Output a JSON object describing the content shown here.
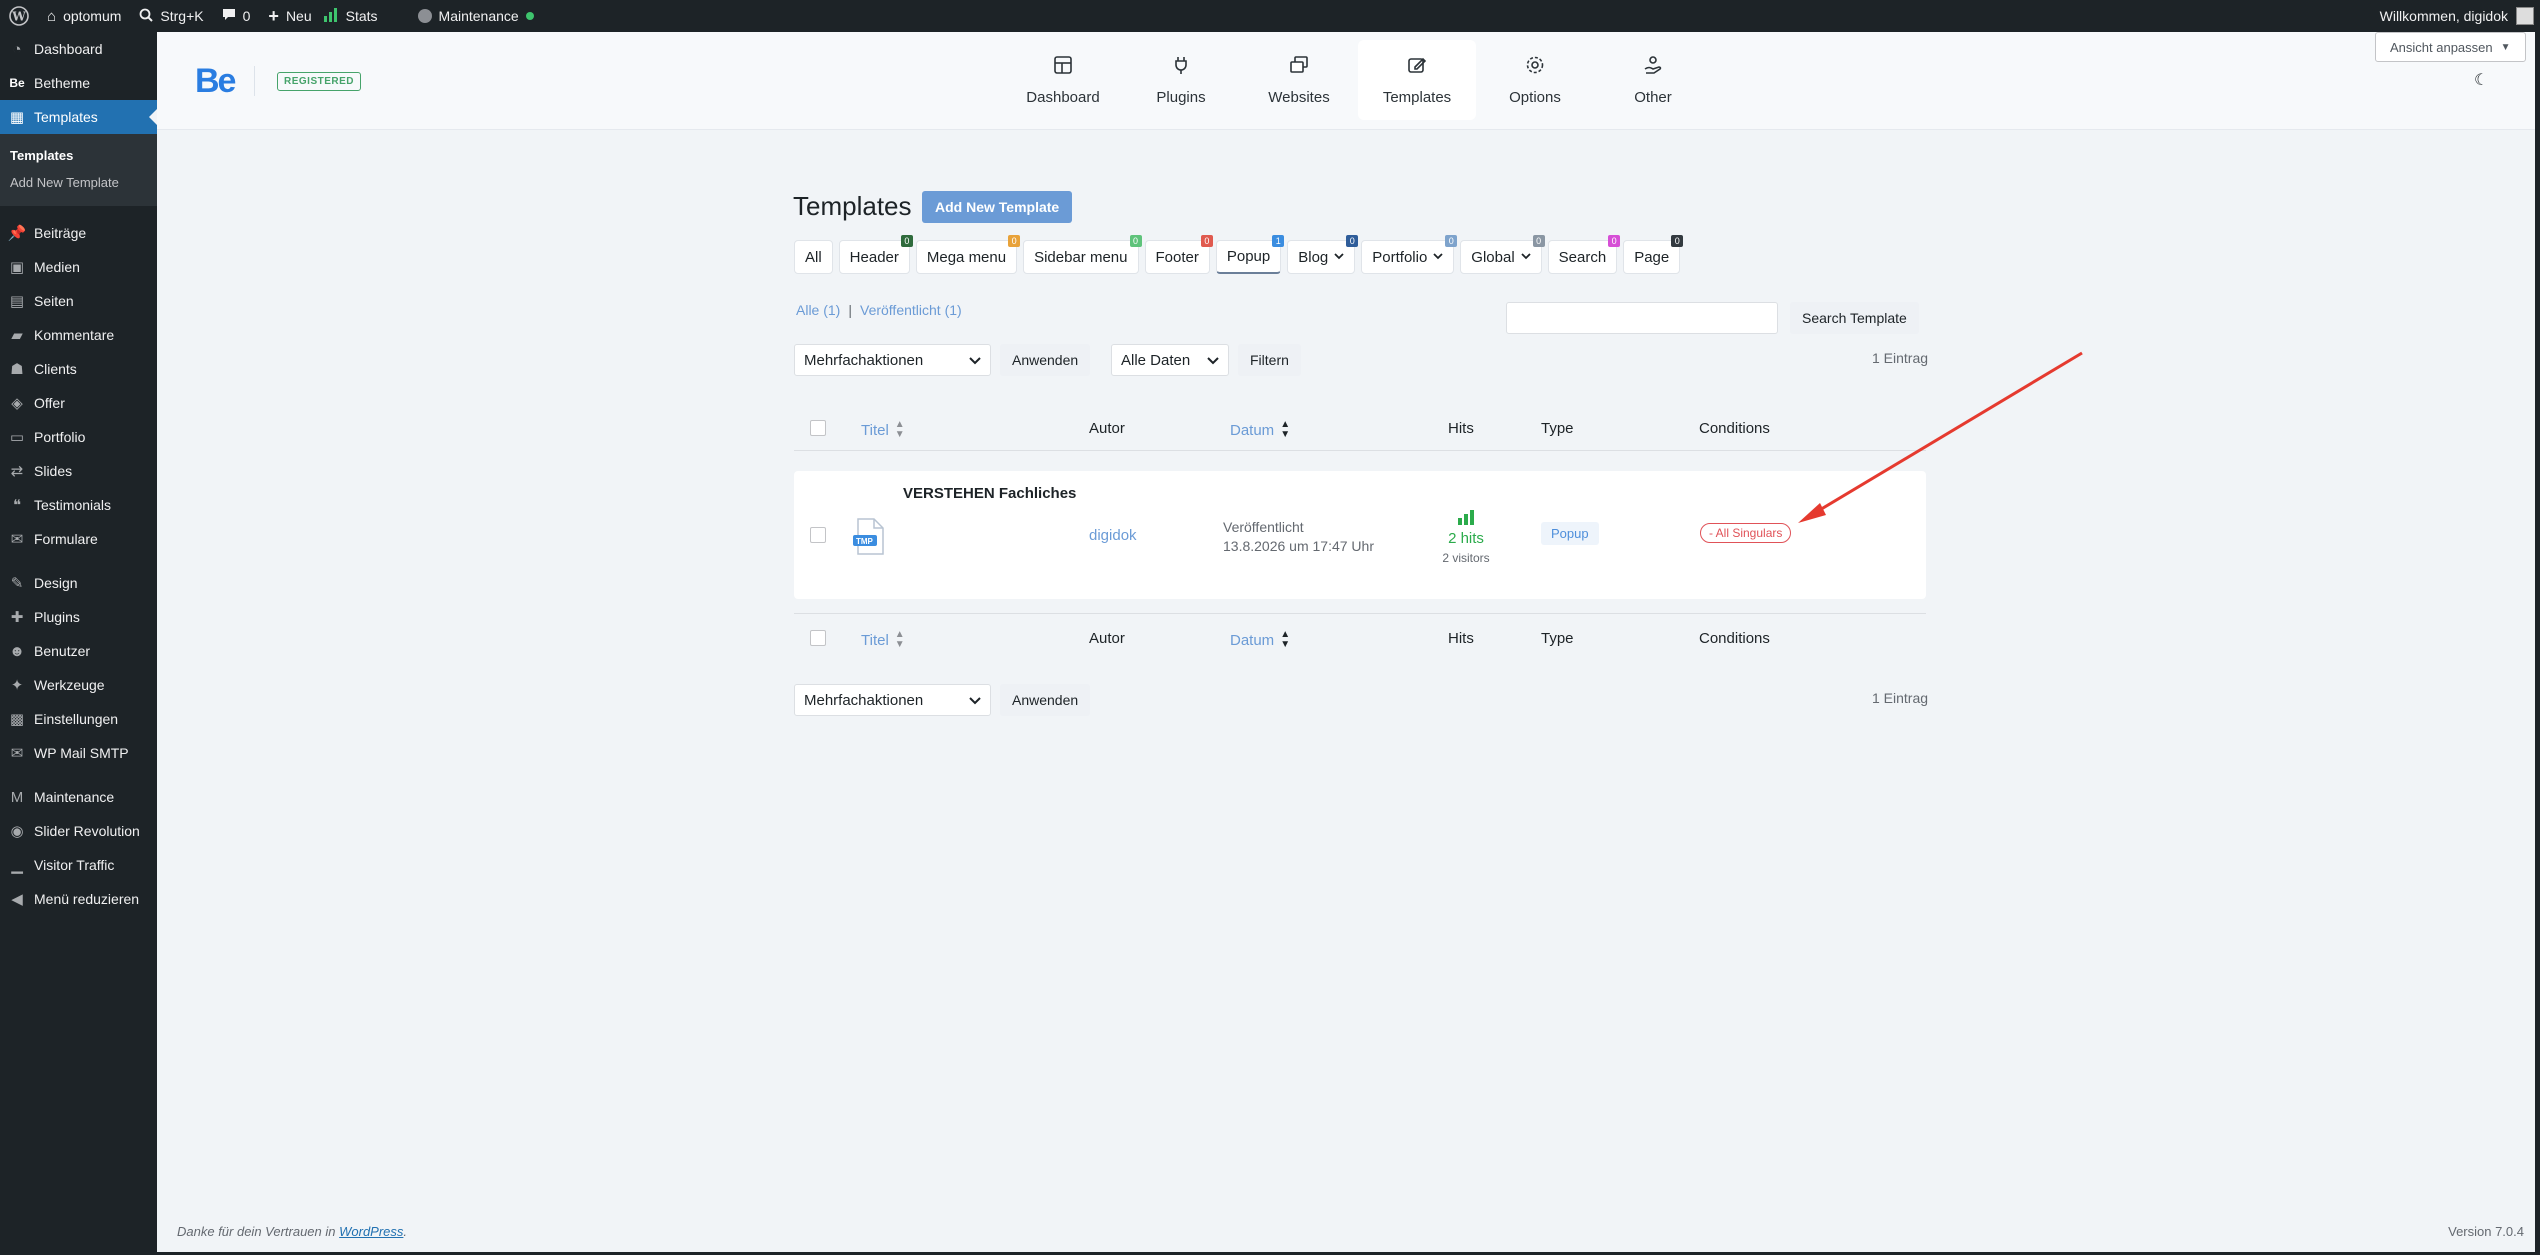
{
  "admin_bar": {
    "site_name": "optomum",
    "search_shortcut": "Strg+K",
    "comments_count": "0",
    "new_label": "Neu",
    "stats_label": "Stats",
    "maintenance_label": "Maintenance",
    "welcome_text": "Willkommen, digidok"
  },
  "sidebar": {
    "items_top": [
      {
        "label": "Dashboard",
        "icon": "dashboard-icon"
      },
      {
        "label": "Betheme",
        "icon": "betheme-icon"
      },
      {
        "label": "Templates",
        "icon": "templates-icon"
      }
    ],
    "submenu": [
      "Templates",
      "Add New Template"
    ],
    "items_mid": [
      {
        "label": "Beiträge",
        "icon": "pin-icon"
      },
      {
        "label": "Medien",
        "icon": "media-icon"
      },
      {
        "label": "Seiten",
        "icon": "pages-icon"
      },
      {
        "label": "Kommentare",
        "icon": "comment-icon"
      },
      {
        "label": "Clients",
        "icon": "clients-icon"
      },
      {
        "label": "Offer",
        "icon": "tag-icon"
      },
      {
        "label": "Portfolio",
        "icon": "portfolio-icon"
      },
      {
        "label": "Slides",
        "icon": "slides-icon"
      },
      {
        "label": "Testimonials",
        "icon": "quote-icon"
      },
      {
        "label": "Formulare",
        "icon": "mail-icon"
      }
    ],
    "items_bottom": [
      {
        "label": "Design",
        "icon": "brush-icon"
      },
      {
        "label": "Plugins",
        "icon": "plugin-icon"
      },
      {
        "label": "Benutzer",
        "icon": "user-icon"
      },
      {
        "label": "Werkzeuge",
        "icon": "wrench-icon"
      },
      {
        "label": "Einstellungen",
        "icon": "settings-icon"
      },
      {
        "label": "WP Mail SMTP",
        "icon": "mail-smtp-icon"
      }
    ],
    "items_end": [
      {
        "label": "Maintenance",
        "icon": "maintenance-icon"
      },
      {
        "label": "Slider Revolution",
        "icon": "revolution-icon"
      },
      {
        "label": "Visitor Traffic",
        "icon": "traffic-icon"
      },
      {
        "label": "Menü reduzieren",
        "icon": "collapse-icon"
      }
    ]
  },
  "be_header": {
    "logo": "Be",
    "registered": "REGISTERED",
    "nav": [
      {
        "label": "Dashboard",
        "icon": "grid-icon"
      },
      {
        "label": "Plugins",
        "icon": "plug-icon"
      },
      {
        "label": "Websites",
        "icon": "websites-icon"
      },
      {
        "label": "Templates",
        "icon": "template-edit-icon"
      },
      {
        "label": "Options",
        "icon": "gear-icon"
      },
      {
        "label": "Other",
        "icon": "hand-icon"
      }
    ],
    "customize": "Ansicht anpassen"
  },
  "main": {
    "title": "Templates",
    "add_button": "Add New Template",
    "tabs": [
      {
        "label": "All",
        "count": "",
        "dropdown": false
      },
      {
        "label": "Header",
        "count": "0",
        "color": "#2f6b3c",
        "dropdown": false
      },
      {
        "label": "Mega menu",
        "count": "0",
        "color": "#e8a23a",
        "dropdown": false
      },
      {
        "label": "Sidebar menu",
        "count": "0",
        "color": "#5fc37b",
        "dropdown": false
      },
      {
        "label": "Footer",
        "count": "0",
        "color": "#e05a4f",
        "dropdown": false
      },
      {
        "label": "Popup",
        "count": "1",
        "color": "#3b8de0",
        "dropdown": false
      },
      {
        "label": "Blog",
        "count": "0",
        "color": "#2f5d9a",
        "dropdown": true
      },
      {
        "label": "Portfolio",
        "count": "0",
        "color": "#7ea3cc",
        "dropdown": true
      },
      {
        "label": "Global",
        "count": "0",
        "color": "#8a96a3",
        "dropdown": true
      },
      {
        "label": "Search",
        "count": "0",
        "color": "#d64fd6",
        "dropdown": false
      },
      {
        "label": "Page",
        "count": "0",
        "color": "#333a40",
        "dropdown": false
      }
    ],
    "views": {
      "all": "Alle (1)",
      "sep": "|",
      "published": "Veröffentlicht (1)"
    },
    "search_button": "Search Template",
    "bulk_action": "Mehrfachaktionen",
    "apply": "Anwenden",
    "dates": "Alle Daten",
    "filter": "Filtern",
    "entries": "1 Eintrag",
    "columns": {
      "title": "Titel",
      "author": "Autor",
      "date": "Datum",
      "hits": "Hits",
      "type": "Type",
      "conditions": "Conditions"
    },
    "row": {
      "title": "VERSTEHEN Fachliches",
      "thumb_label": "TMP",
      "author": "digidok",
      "status": "Veröffentlicht",
      "date": "13.8.2026 um 17:47 Uhr",
      "hits": "2 hits",
      "visitors": "2 visitors",
      "type": "Popup",
      "condition": "- All Singulars"
    }
  },
  "footer": {
    "thanks_prefix": "Danke für dein Vertrauen in ",
    "thanks_link": "WordPress",
    "thanks_suffix": ".",
    "version": "Version 7.0.4"
  },
  "colors": {
    "accent": "#6b9bd6",
    "admin_dark": "#1d2327",
    "current_menu": "#2271b1",
    "annotation_arrow": "#e53a2f"
  }
}
